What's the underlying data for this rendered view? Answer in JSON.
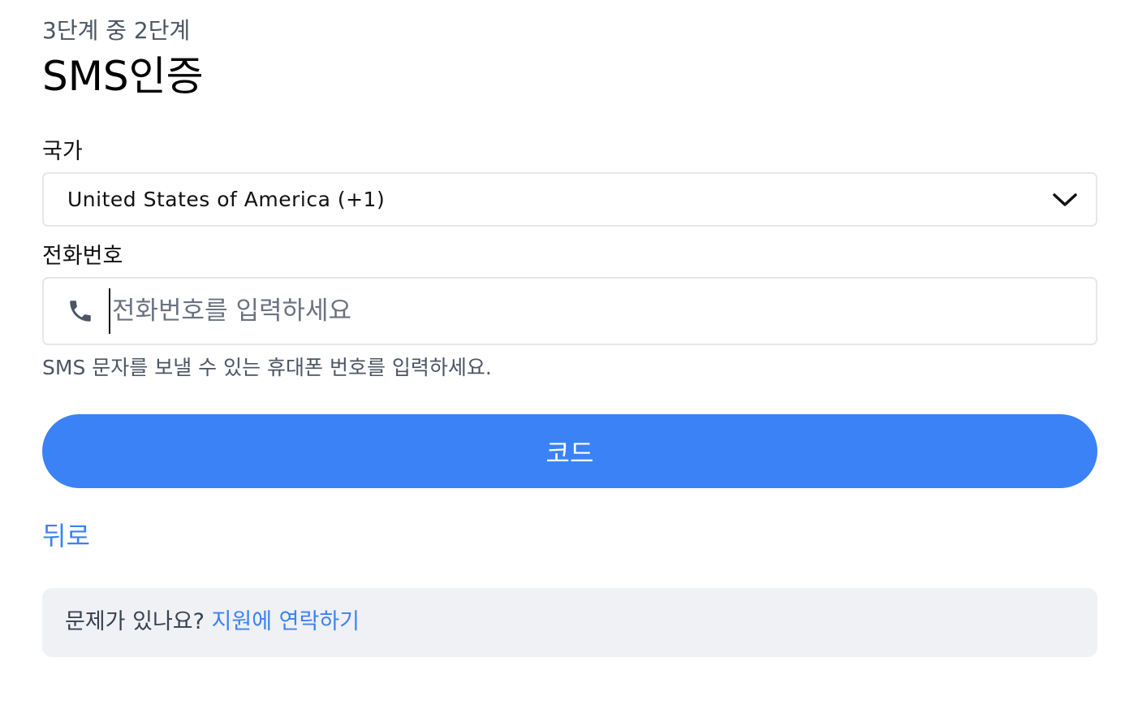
{
  "header": {
    "step_text": "3단계 중 2단계",
    "title": "SMS인증"
  },
  "form": {
    "country_label": "국가",
    "country_value": "United States of America (+1)",
    "phone_label": "전화번호",
    "phone_placeholder": "전화번호를 입력하세요",
    "phone_value": "",
    "help_text": "SMS 문자를 보낼 수 있는 휴대폰 번호를 입력하세요.",
    "submit_label": "코드"
  },
  "navigation": {
    "back_label": "뒤로"
  },
  "support": {
    "question": "문제가 있나요?",
    "link_label": "지원에 연락하기"
  },
  "icons": {
    "dropdown": "chevron-down-icon",
    "phone": "phone-icon"
  },
  "colors": {
    "accent": "#3b82f6",
    "muted_text": "#4b5563",
    "border": "#e5e7eb",
    "help_box_bg": "#f0f1f5"
  }
}
